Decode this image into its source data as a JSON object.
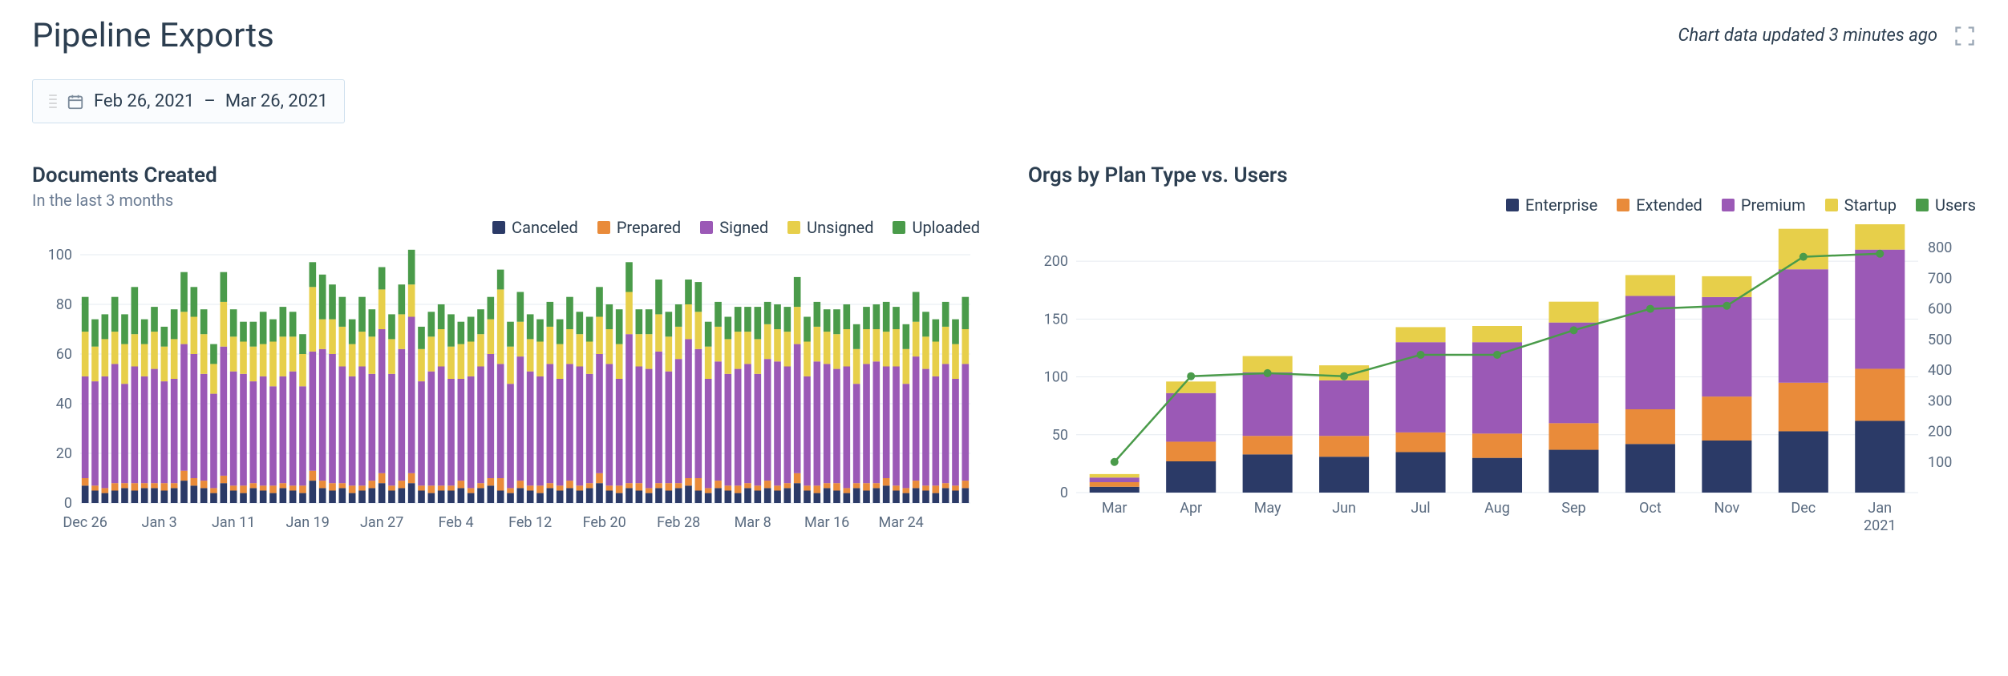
{
  "header": {
    "title": "Pipeline Exports",
    "updated_text": "Chart data updated 3 minutes ago"
  },
  "date_picker": {
    "start": "Feb 26, 2021",
    "separator": "–",
    "end": "Mar 26, 2021"
  },
  "colors": {
    "canceled": "#2b3a67",
    "prepared": "#e98b3a",
    "signed": "#9b59b6",
    "unsigned": "#e7cf4a",
    "uploaded": "#4a9b4a",
    "enterprise": "#2b3a67",
    "extended": "#e98b3a",
    "premium": "#9b59b6",
    "startup": "#e7cf4a",
    "users": "#4a9b4a"
  },
  "chart_data": [
    {
      "id": "documents_created",
      "type": "bar",
      "title": "Documents Created",
      "subtitle": "In the last 3 months",
      "x_tick_labels": [
        "Dec 26",
        "Jan 3",
        "Jan 11",
        "Jan 19",
        "Jan 27",
        "Feb 4",
        "Feb 12",
        "Feb 20",
        "Feb 28",
        "Mar 8",
        "Mar 16",
        "Mar 24"
      ],
      "ylim": [
        0,
        100
      ],
      "y_ticks": [
        0,
        20,
        40,
        60,
        80,
        100
      ],
      "legend": [
        "Canceled",
        "Prepared",
        "Signed",
        "Unsigned",
        "Uploaded"
      ],
      "series": [
        {
          "name": "Canceled",
          "values": [
            7,
            5,
            4,
            5,
            6,
            5,
            6,
            6,
            5,
            6,
            9,
            7,
            6,
            4,
            8,
            5,
            4,
            6,
            5,
            4,
            6,
            5,
            4,
            9,
            6,
            5,
            6,
            4,
            5,
            6,
            8,
            5,
            6,
            8,
            5,
            4,
            5,
            5,
            6,
            4,
            6,
            7,
            5,
            4,
            6,
            5,
            4,
            6,
            5,
            6,
            5,
            6,
            8,
            5,
            4,
            6,
            5,
            4,
            6,
            5,
            6,
            7,
            5,
            4,
            6,
            5,
            4,
            6,
            5,
            6,
            5,
            6,
            8,
            5,
            4,
            6,
            5,
            4,
            6,
            5,
            6,
            7,
            5,
            4,
            6,
            5,
            4,
            6,
            5,
            6
          ]
        },
        {
          "name": "Prepared",
          "values": [
            3,
            2,
            2,
            3,
            2,
            3,
            2,
            2,
            3,
            2,
            4,
            3,
            3,
            2,
            3,
            2,
            3,
            2,
            2,
            3,
            2,
            2,
            3,
            4,
            3,
            3,
            2,
            3,
            2,
            3,
            4,
            2,
            3,
            4,
            2,
            3,
            2,
            2,
            3,
            2,
            2,
            3,
            5,
            2,
            3,
            2,
            3,
            2,
            2,
            3,
            2,
            2,
            4,
            2,
            3,
            2,
            3,
            2,
            2,
            3,
            2,
            3,
            5,
            2,
            3,
            2,
            3,
            2,
            2,
            3,
            2,
            2,
            4,
            2,
            3,
            2,
            3,
            2,
            2,
            3,
            2,
            3,
            2,
            2,
            3,
            2,
            3,
            2,
            2,
            3
          ]
        },
        {
          "name": "Signed",
          "values": [
            41,
            42,
            45,
            48,
            40,
            47,
            43,
            46,
            41,
            42,
            51,
            50,
            43,
            38,
            52,
            46,
            45,
            41,
            44,
            40,
            43,
            46,
            40,
            48,
            53,
            52,
            47,
            44,
            48,
            43,
            58,
            45,
            53,
            63,
            42,
            46,
            48,
            43,
            41,
            45,
            47,
            50,
            46,
            42,
            50,
            46,
            44,
            48,
            43,
            47,
            48,
            44,
            48,
            49,
            43,
            60,
            47,
            48,
            53,
            45,
            50,
            56,
            52,
            44,
            48,
            45,
            47,
            48,
            45,
            49,
            50,
            47,
            52,
            44,
            50,
            48,
            46,
            49,
            40,
            48,
            49,
            45,
            48,
            42,
            50,
            47,
            44,
            48,
            43,
            47
          ]
        },
        {
          "name": "Unsigned",
          "values": [
            18,
            14,
            15,
            13,
            16,
            13,
            13,
            15,
            14,
            16,
            13,
            15,
            16,
            12,
            18,
            14,
            13,
            14,
            13,
            18,
            16,
            14,
            13,
            26,
            12,
            14,
            16,
            13,
            14,
            15,
            16,
            14,
            14,
            13,
            13,
            14,
            15,
            13,
            14,
            14,
            13,
            14,
            30,
            15,
            14,
            13,
            14,
            15,
            14,
            14,
            13,
            13,
            15,
            14,
            14,
            17,
            13,
            14,
            15,
            14,
            13,
            14,
            15,
            13,
            14,
            14,
            15,
            13,
            14,
            14,
            13,
            14,
            15,
            14,
            14,
            13,
            14,
            15,
            14,
            14,
            13,
            14,
            15,
            14,
            14,
            13,
            14,
            15,
            14,
            14
          ]
        },
        {
          "name": "Uploaded",
          "values": [
            14,
            11,
            10,
            14,
            12,
            19,
            10,
            10,
            8,
            12,
            16,
            12,
            10,
            8,
            12,
            11,
            8,
            10,
            13,
            9,
            12,
            10,
            8,
            10,
            18,
            14,
            12,
            10,
            14,
            11,
            9,
            10,
            12,
            14,
            9,
            10,
            10,
            13,
            9,
            10,
            10,
            9,
            8,
            10,
            12,
            10,
            9,
            10,
            10,
            13,
            9,
            10,
            12,
            10,
            14,
            12,
            10,
            10,
            14,
            10,
            9,
            10,
            12,
            10,
            10,
            9,
            10,
            10,
            13,
            9,
            10,
            10,
            12,
            10,
            10,
            9,
            10,
            10,
            10,
            9,
            10,
            12,
            9,
            10,
            12,
            10,
            9,
            10,
            10,
            13
          ]
        }
      ]
    },
    {
      "id": "orgs_by_plan",
      "type": "bar+line",
      "title": "Orgs by Plan Type vs. Users",
      "categories": [
        "Mar",
        "Apr",
        "May",
        "Jun",
        "Jul",
        "Aug",
        "Sep",
        "Oct",
        "Nov",
        "Dec",
        "Jan 2021"
      ],
      "ylim_left": [
        0,
        225
      ],
      "y_ticks_left": [
        0,
        50,
        100,
        150,
        200
      ],
      "ylim_right": [
        0,
        850
      ],
      "y_ticks_right": [
        100,
        200,
        300,
        400,
        500,
        600,
        700,
        800
      ],
      "legend": [
        "Enterprise",
        "Extended",
        "Premium",
        "Startup",
        "Users"
      ],
      "series": [
        {
          "name": "Enterprise",
          "axis": "left",
          "type": "bar",
          "values": [
            5,
            27,
            33,
            31,
            35,
            30,
            37,
            42,
            45,
            53,
            62
          ]
        },
        {
          "name": "Extended",
          "axis": "left",
          "type": "bar",
          "values": [
            4,
            17,
            16,
            18,
            17,
            21,
            23,
            30,
            38,
            42,
            45
          ]
        },
        {
          "name": "Premium",
          "axis": "left",
          "type": "bar",
          "values": [
            4,
            42,
            55,
            48,
            78,
            79,
            87,
            98,
            86,
            98,
            103
          ]
        },
        {
          "name": "Startup",
          "axis": "left",
          "type": "bar",
          "values": [
            3,
            10,
            14,
            13,
            13,
            14,
            18,
            18,
            18,
            35,
            27
          ]
        },
        {
          "name": "Users",
          "axis": "right",
          "type": "line",
          "values": [
            100,
            380,
            390,
            380,
            450,
            450,
            530,
            600,
            610,
            770,
            780
          ]
        }
      ]
    }
  ]
}
